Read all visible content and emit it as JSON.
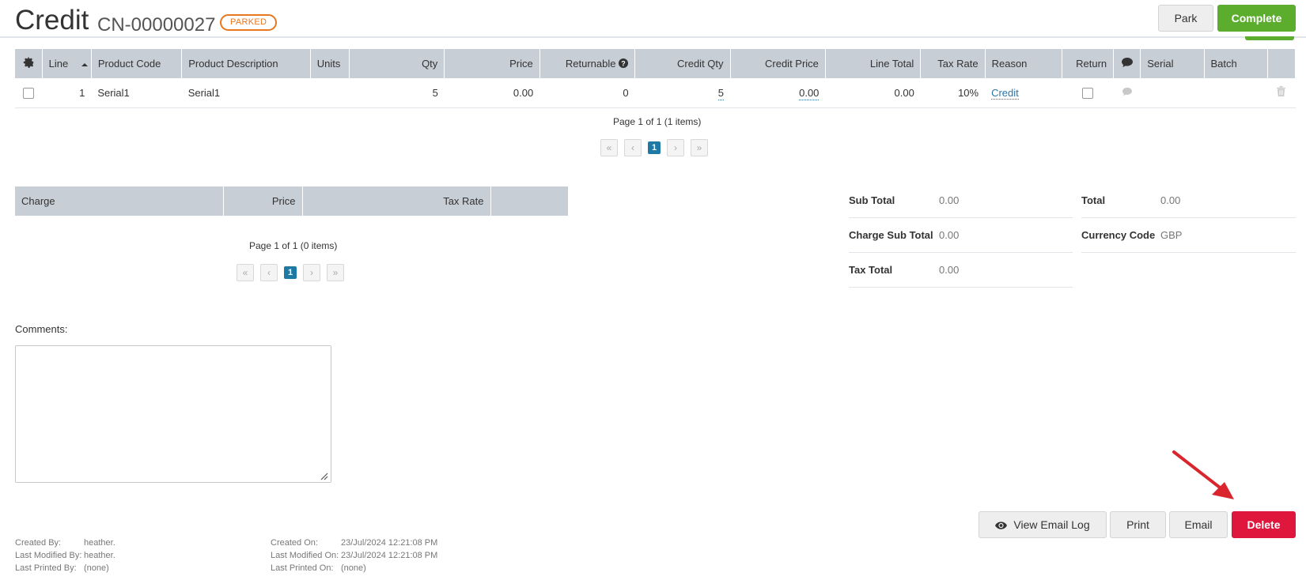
{
  "header": {
    "title": "Credit",
    "doc_number": "CN-00000027",
    "status": "PARKED",
    "park_label": "Park",
    "complete_label": "Complete"
  },
  "items_table": {
    "columns": [
      "Line",
      "Product Code",
      "Product Description",
      "Units",
      "Qty",
      "Price",
      "Returnable",
      "Credit Qty",
      "Credit Price",
      "Line Total",
      "Tax Rate",
      "Reason",
      "Return",
      "Serial",
      "Batch"
    ],
    "rows": [
      {
        "line": "1",
        "product_code": "Serial1",
        "product_description": "Serial1",
        "units": "",
        "qty": "5",
        "price": "0.00",
        "returnable": "0",
        "credit_qty": "5",
        "credit_price": "0.00",
        "line_total": "0.00",
        "tax_rate": "10%",
        "reason": "Credit",
        "serial": "",
        "batch": ""
      }
    ],
    "pager_text": "Page 1 of 1 (1 items)",
    "current_page": "1"
  },
  "charges_table": {
    "columns": [
      "Charge",
      "Price",
      "Tax Rate"
    ],
    "pager_text": "Page 1 of 1 (0 items)",
    "current_page": "1"
  },
  "totals": {
    "sub_total_label": "Sub Total",
    "sub_total": "0.00",
    "charge_sub_total_label": "Charge Sub Total",
    "charge_sub_total": "0.00",
    "tax_total_label": "Tax Total",
    "tax_total": "0.00",
    "total_label": "Total",
    "total": "0.00",
    "currency_code_label": "Currency Code",
    "currency_code": "GBP"
  },
  "comments": {
    "label": "Comments:",
    "value": ""
  },
  "actions": {
    "view_email_log": "View Email Log",
    "print": "Print",
    "email": "Email",
    "delete": "Delete"
  },
  "audit": {
    "created_by_label": "Created By:",
    "created_by": "heather.",
    "last_modified_by_label": "Last Modified By:",
    "last_modified_by": "heather.",
    "last_printed_by_label": "Last Printed By:",
    "last_printed_by": "(none)",
    "created_on_label": "Created On:",
    "created_on": "23/Jul/2024 12:21:08 PM",
    "last_modified_on_label": "Last Modified On:",
    "last_modified_on": "23/Jul/2024 12:21:08 PM",
    "last_printed_on_label": "Last Printed On:",
    "last_printed_on": "(none)"
  },
  "colors": {
    "accent_green": "#5cad2d",
    "danger_red": "#e0173c",
    "status_orange": "#e8771e",
    "header_gray": "#c8ced6",
    "pager_blue": "#1e7aa5"
  },
  "icons": [
    "gear-icon",
    "sort-asc-icon",
    "help-circle-icon",
    "comment-icon",
    "trash-icon",
    "eye-icon",
    "annotation-arrow"
  ]
}
